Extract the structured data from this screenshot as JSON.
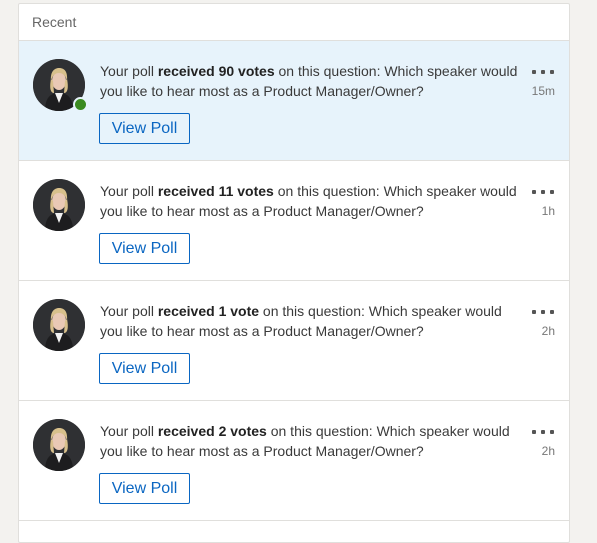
{
  "header": {
    "title": "Recent"
  },
  "notifications": [
    {
      "prefix": "Your poll ",
      "bold": "received 90 votes",
      "suffix": " on this question: Which speaker would you like to hear most as a Product Manager/Owner?",
      "button": "View Poll",
      "time": "15m",
      "unread": true,
      "online": true
    },
    {
      "prefix": "Your poll ",
      "bold": "received 11 votes",
      "suffix": " on this question: Which speaker would you like to hear most as a Product Manager/Owner?",
      "button": "View Poll",
      "time": "1h",
      "unread": false,
      "online": false
    },
    {
      "prefix": "Your poll ",
      "bold": "received 1 vote",
      "suffix": " on this question: Which speaker would you like to hear most as a Product Manager/Owner?",
      "button": "View Poll",
      "time": "2h",
      "unread": false,
      "online": false
    },
    {
      "prefix": "Your poll ",
      "bold": "received 2 votes",
      "suffix": " on this question: Which speaker would you like to hear most as a Product Manager/Owner?",
      "button": "View Poll",
      "time": "2h",
      "unread": false,
      "online": false
    }
  ],
  "icons": {
    "avatar": "profile-photo",
    "more": "more-options-icon",
    "presence": "online-status-dot"
  },
  "colors": {
    "accent": "#0a66c2",
    "unread_bg": "#e7f3fb",
    "online": "#3a8a1f"
  }
}
